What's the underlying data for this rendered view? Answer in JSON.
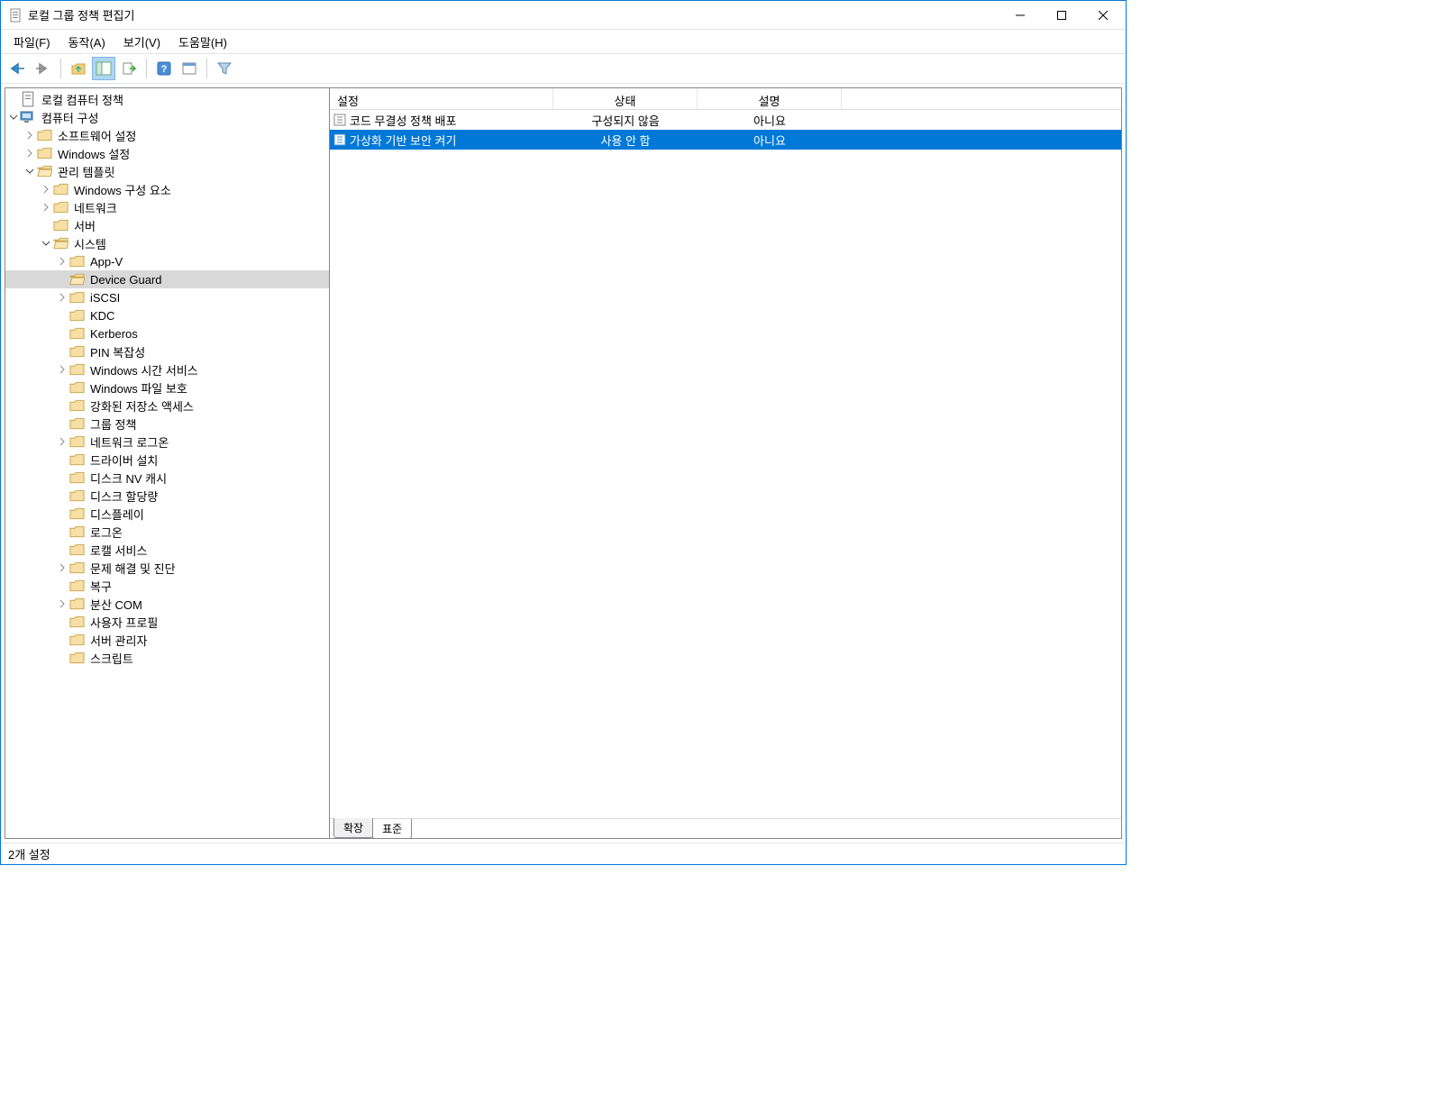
{
  "window": {
    "title": "로컬 그룹 정책 편집기"
  },
  "menu": {
    "file": "파일(F)",
    "action": "동작(A)",
    "view": "보기(V)",
    "help": "도움말(H)"
  },
  "tree": {
    "root": "로컬 컴퓨터 정책",
    "computer_config": "컴퓨터 구성",
    "software_settings": "소프트웨어 설정",
    "windows_settings": "Windows 설정",
    "admin_templates": "관리 템플릿",
    "windows_components": "Windows 구성 요소",
    "network": "네트워크",
    "server": "서버",
    "system": "시스템",
    "appv": "App-V",
    "device_guard": "Device Guard",
    "iscsi": "iSCSI",
    "kdc": "KDC",
    "kerberos": "Kerberos",
    "pin_complexity": "PIN 복잡성",
    "windows_time": "Windows 시간 서비스",
    "windows_file_protect": "Windows 파일 보호",
    "enhanced_storage": "강화된 저장소 액세스",
    "group_policy": "그룹 정책",
    "net_logon": "네트워크 로그온",
    "driver_install": "드라이버 설치",
    "disk_nv_cache": "디스크 NV 캐시",
    "disk_quotas": "디스크 할당량",
    "display": "디스플레이",
    "logon": "로그온",
    "locale_services": "로캘 서비스",
    "troubleshooting": "문제 해결 및 진단",
    "recovery": "복구",
    "dcom": "분산 COM",
    "user_profiles": "사용자 프로필",
    "server_manager": "서버 관리자",
    "scripts": "스크립트"
  },
  "columns": {
    "setting": "설정",
    "state": "상태",
    "description": "설명"
  },
  "rows": [
    {
      "setting": "코드 무결성 정책 배포",
      "state": "구성되지 않음",
      "desc": "아니요",
      "selected": false
    },
    {
      "setting": "가상화 기반 보안 켜기",
      "state": "사용 안 함",
      "desc": "아니요",
      "selected": true
    }
  ],
  "tabs": {
    "extended": "확장",
    "standard": "표준"
  },
  "statusbar": "2개 설정"
}
